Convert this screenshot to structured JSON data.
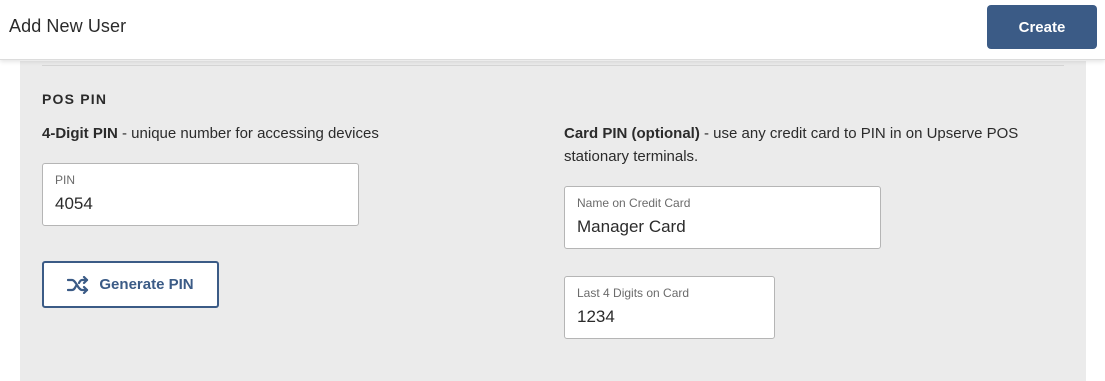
{
  "header": {
    "title": "Add New User",
    "create_label": "Create"
  },
  "pos_pin": {
    "section_title": "POS PIN",
    "pin_desc_bold": "4-Digit PIN",
    "pin_desc_rest": " - unique number for accessing devices",
    "pin_field": {
      "label": "PIN",
      "value": "4054"
    },
    "generate_label": "Generate PIN",
    "card_desc_bold": "Card PIN (optional)",
    "card_desc_rest": " - use any credit card to PIN in on Upserve POS stationary terminals.",
    "name_field": {
      "label": "Name on Credit Card",
      "value": "Manager Card"
    },
    "digits_field": {
      "label": "Last 4 Digits on Card",
      "value": "1234"
    }
  },
  "icons": {
    "generate": "shuffle-icon"
  },
  "colors": {
    "accent": "#3b5b86",
    "panel_bg": "#ebebeb"
  }
}
